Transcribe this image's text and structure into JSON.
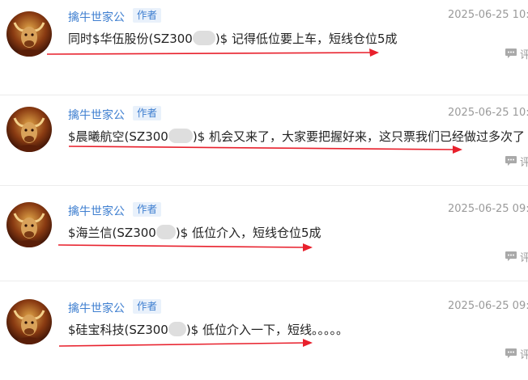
{
  "colors": {
    "author": "#3f7fd0",
    "badge_bg": "#e9f1fb",
    "annotation_arrow": "#e8202c"
  },
  "posts": [
    {
      "author": "擒牛世家公",
      "badge": "作者",
      "time": "2025-06-25 10:5",
      "text_before": "同时$华伍股份(SZ300",
      "text_after": ")$ 记得低位要上车，短线仓位5成",
      "reply": "评"
    },
    {
      "author": "擒牛世家公",
      "badge": "作者",
      "time": "2025-06-25 10:4",
      "text_before": "$晨曦航空(SZ300",
      "text_after": ")$ 机会又来了，大家要把握好来，这只票我们已经做过多次了",
      "reply": "评"
    },
    {
      "author": "擒牛世家公",
      "badge": "作者",
      "time": "2025-06-25 09:4",
      "text_before": "$海兰信(SZ300",
      "text_after": ")$ 低位介入，短线仓位5成",
      "reply": "评"
    },
    {
      "author": "擒牛世家公",
      "badge": "作者",
      "time": "2025-06-25 09:3",
      "text_before": "$硅宝科技(SZ300",
      "text_after": ")$ 低位介入一下，短线。。。。。",
      "reply": "评"
    }
  ]
}
